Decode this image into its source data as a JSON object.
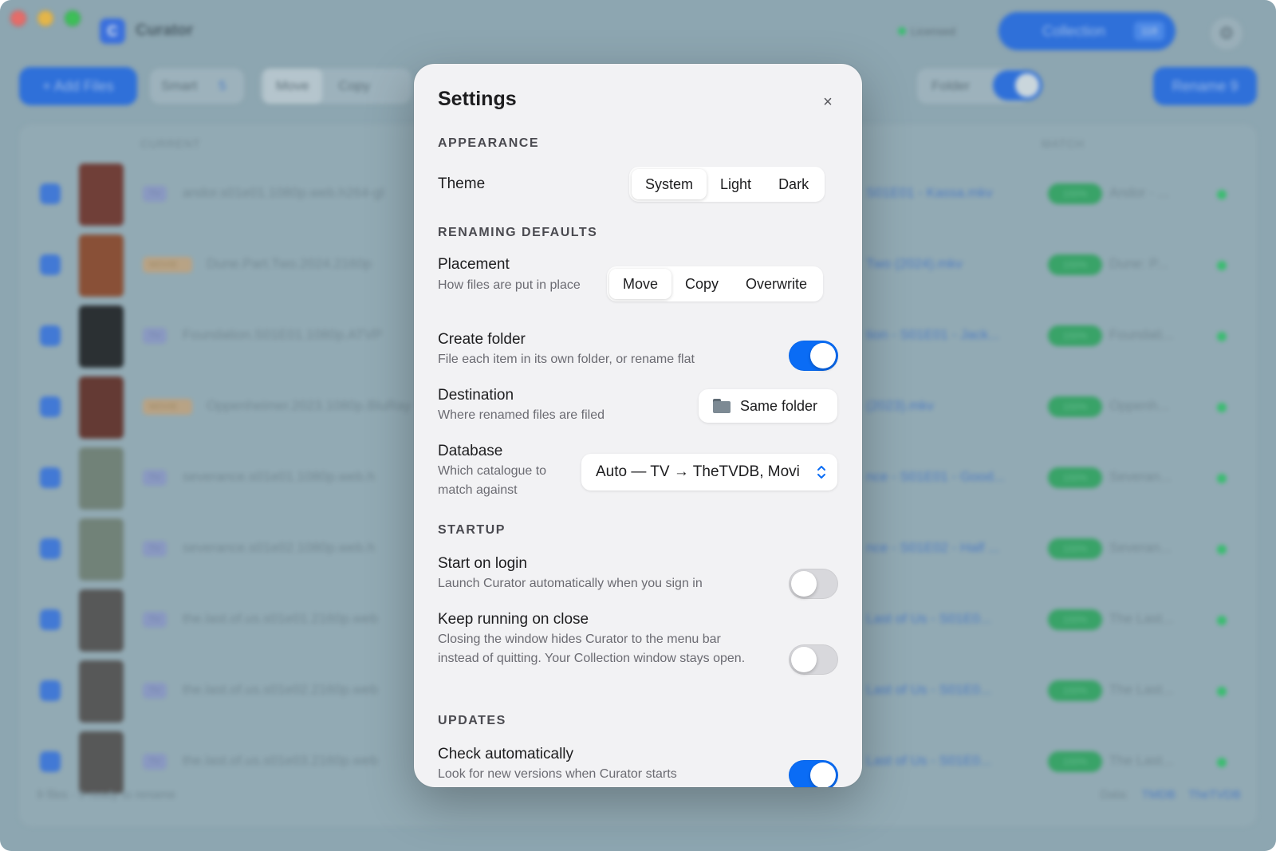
{
  "window": {
    "app_title": "Curator",
    "status": "Licensed",
    "collection_button": "Collection",
    "collection_count": "118"
  },
  "toolbar": {
    "add_files": "+ Add Files",
    "smart": "Smart",
    "smart_count": "5",
    "move": "Move",
    "copy": "Copy",
    "folder": "Folder",
    "rename": "Rename 9"
  },
  "table": {
    "col_current": "CURRENT",
    "col_match": "MATCH",
    "rows": [
      {
        "badge": "TV",
        "current": "andor.s01e01.1080p.web.h264-gl",
        "new": "S01E01 - Kassa.mkv",
        "pct": "100%",
        "match": "Andor · ..."
      },
      {
        "badge": "MOVIE",
        "current": "Dune.Part.Two.2024.2160p",
        "new": "Two (2024).mkv",
        "pct": "100%",
        "match": "Dune: P..."
      },
      {
        "badge": "TV",
        "current": "Foundation.S01E01.1080p.ATVP",
        "new": "tion - S01E01 - Jack...",
        "pct": "100%",
        "match": "Foundati..."
      },
      {
        "badge": "MOVIE",
        "current": "Oppenheimer.2023.1080p.BluRay",
        "new": "(2023).mkv",
        "pct": "100%",
        "match": "Oppenh..."
      },
      {
        "badge": "TV",
        "current": "severance.s01e01.1080p.web.h",
        "new": "nce - S01E01 - Good...",
        "pct": "100%",
        "match": "Severan..."
      },
      {
        "badge": "TV",
        "current": "severance.s01e02.1080p.web.h",
        "new": "nce - S01E02 - Half ...",
        "pct": "100%",
        "match": "Severan..."
      },
      {
        "badge": "TV",
        "current": "the.last.of.us.s01e01.2160p.web",
        "new": "Last of Us - S01E0...",
        "pct": "100%",
        "match": "The Last..."
      },
      {
        "badge": "TV",
        "current": "the.last.of.us.s01e02.2160p.web",
        "new": "Last of Us - S01E0...",
        "pct": "100%",
        "match": "The Last..."
      },
      {
        "badge": "TV",
        "current": "the.last.of.us.s01e03.2160p.web",
        "new": "Last of Us - S01E0...",
        "pct": "100%",
        "match": "The Last..."
      }
    ],
    "footer_left": "9 files · 9 ready to rename",
    "footer_data": "Data:",
    "footer_tmdb": "TMDB",
    "footer_tvdb": "TheTVDB"
  },
  "settings": {
    "title": "Settings",
    "close": "×",
    "appearance": {
      "section": "APPEARANCE",
      "theme_label": "Theme",
      "theme_options": [
        "System",
        "Light",
        "Dark"
      ],
      "theme_selected": "System"
    },
    "renaming": {
      "section": "RENAMING DEFAULTS",
      "placement_label": "Placement",
      "placement_desc": "How files are put in place",
      "placement_options": [
        "Move",
        "Copy",
        "Overwrite"
      ],
      "placement_selected": "Move",
      "create_folder_label": "Create folder",
      "create_folder_desc": "File each item in its own folder, or rename flat",
      "create_folder_on": true,
      "destination_label": "Destination",
      "destination_desc": "Where renamed files are filed",
      "destination_value": "Same folder",
      "database_label": "Database",
      "database_desc": "Which catalogue to match against",
      "database_value": "Auto — TV → TheTVDB, Movies → TMDB"
    },
    "startup": {
      "section": "STARTUP",
      "login_label": "Start on login",
      "login_desc": "Launch Curator automatically when you sign in",
      "login_on": false,
      "keep_label": "Keep running on close",
      "keep_desc": "Closing the window hides Curator to the menu bar instead of quitting. Your Collection window stays open.",
      "keep_on": false
    },
    "updates": {
      "section": "UPDATES",
      "check_label": "Check automatically",
      "check_desc": "Look for new versions when Curator starts",
      "check_on": true
    }
  },
  "colors": {
    "accent": "#0a6cf5",
    "sheet_bg": "#f2f2f4"
  }
}
